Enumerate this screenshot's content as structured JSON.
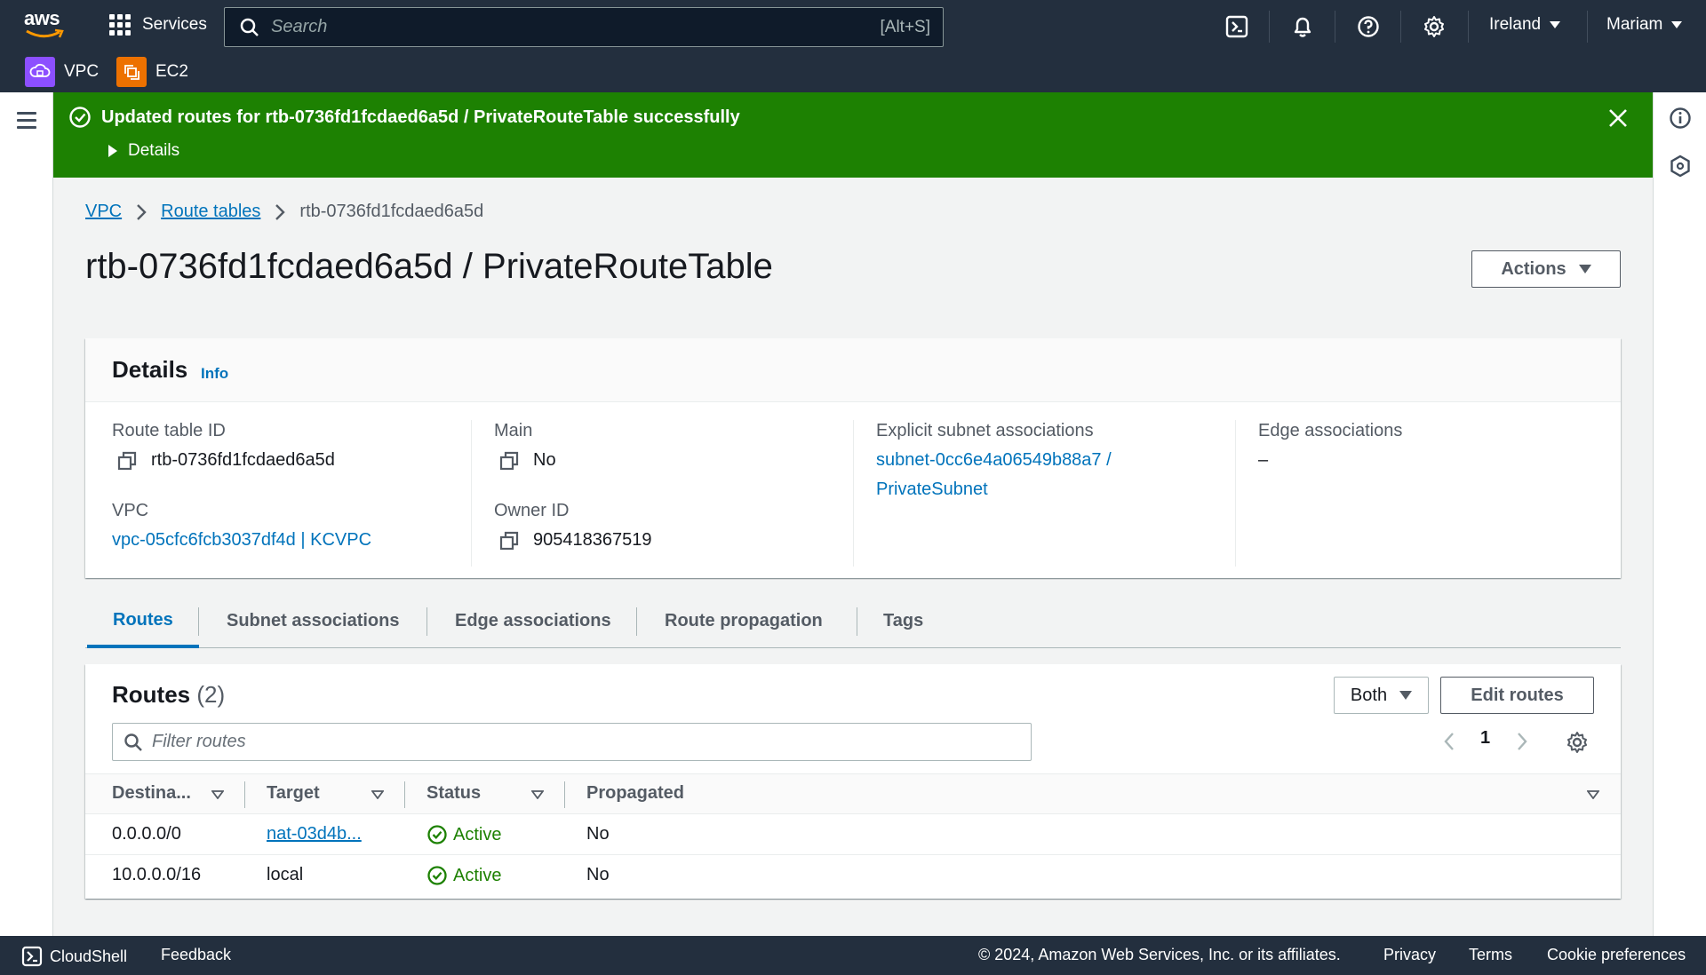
{
  "topnav": {
    "logo_text": "aws",
    "services_label": "Services",
    "search_placeholder": "Search",
    "search_shortcut": "[Alt+S]",
    "region": "Ireland",
    "user": "Mariam",
    "icons": [
      "cloudshell-icon",
      "bell-icon",
      "help-icon",
      "gear-icon"
    ]
  },
  "favorites": [
    {
      "label": "VPC",
      "color": "#8c4fff",
      "icon": "vpc-icon"
    },
    {
      "label": "EC2",
      "color": "#ed7100",
      "icon": "ec2-icon"
    }
  ],
  "flash": {
    "message": "Updated routes for rtb-0736fd1fcdaed6a5d / PrivateRouteTable successfully",
    "details_label": "Details",
    "color": "#1d8102"
  },
  "breadcrumb": {
    "items": [
      "VPC",
      "Route tables"
    ],
    "current": "rtb-0736fd1fcdaed6a5d"
  },
  "page": {
    "title": "rtb-0736fd1fcdaed6a5d / PrivateRouteTable",
    "actions_label": "Actions"
  },
  "details": {
    "heading": "Details",
    "info_label": "Info",
    "route_table_id_label": "Route table ID",
    "route_table_id": "rtb-0736fd1fcdaed6a5d",
    "vpc_label": "VPC",
    "vpc_value": "vpc-05cfc6fcb3037df4d | KCVPC",
    "main_label": "Main",
    "main_value": "No",
    "owner_label": "Owner ID",
    "owner_value": "905418367519",
    "explicit_label": "Explicit subnet associations",
    "explicit_line1": "subnet-0cc6e4a06549b88a7 /",
    "explicit_line2": "PrivateSubnet",
    "edge_label": "Edge associations",
    "edge_value": "–"
  },
  "tabs": [
    {
      "label": "Routes",
      "active": true
    },
    {
      "label": "Subnet associations",
      "active": false
    },
    {
      "label": "Edge associations",
      "active": false
    },
    {
      "label": "Route propagation",
      "active": false
    },
    {
      "label": "Tags",
      "active": false
    }
  ],
  "routes": {
    "title": "Routes",
    "count": "(2)",
    "filter_select": "Both",
    "edit_label": "Edit routes",
    "filter_placeholder": "Filter routes",
    "page": "1",
    "columns": [
      "Destina...",
      "Target",
      "Status",
      "Propagated"
    ],
    "rows": [
      {
        "destination": "0.0.0.0/0",
        "target": "nat-03d4b...",
        "target_link": true,
        "status": "Active",
        "propagated": "No"
      },
      {
        "destination": "10.0.0.0/16",
        "target": "local",
        "target_link": false,
        "status": "Active",
        "propagated": "No"
      }
    ]
  },
  "footer": {
    "cloudshell": "CloudShell",
    "feedback": "Feedback",
    "copyright": "© 2024, Amazon Web Services, Inc. or its affiliates.",
    "privacy": "Privacy",
    "terms": "Terms",
    "cookies": "Cookie preferences"
  }
}
